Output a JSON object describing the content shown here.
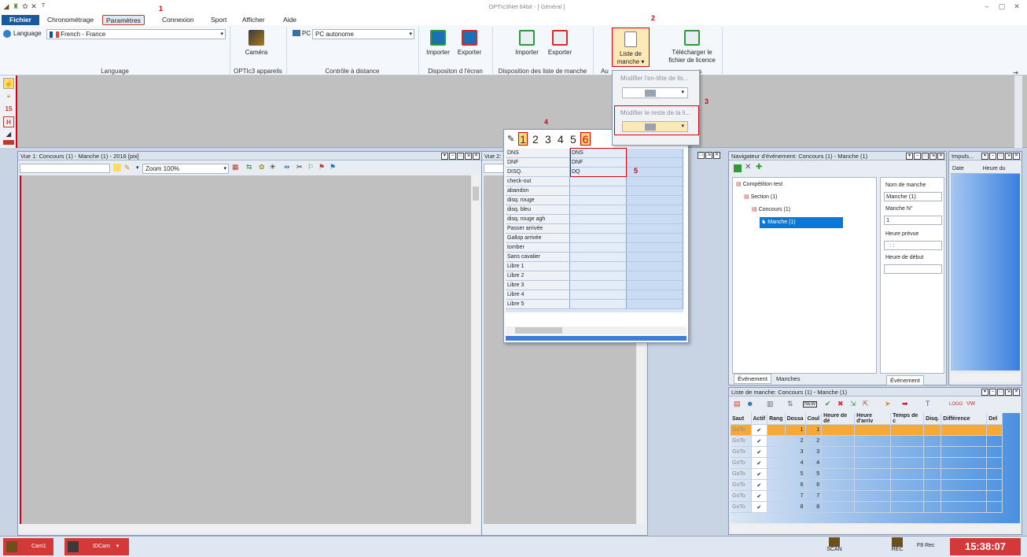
{
  "window": {
    "title": "OPTIc3Net 64bit - [ Général ]",
    "controls": [
      "–",
      "▢",
      "✕"
    ]
  },
  "menu": {
    "file": "Fichier",
    "items": [
      "Chronométrage",
      "Paramètres",
      "Connexion",
      "Sport",
      "Afficher",
      "Aide"
    ]
  },
  "annotations": [
    "1",
    "2",
    "3",
    "4",
    "5"
  ],
  "ribbon": {
    "language_label": "Language",
    "language_value": "French - France",
    "camera_label": "Caméra",
    "pc_label": "PC",
    "pc_value": "PC autonome",
    "btn_importer": "Importer",
    "btn_exporter": "Exporter",
    "btn_liste_line1": "Liste de",
    "btn_liste_line2": "manche ▾",
    "btn_telecharger_line1": "Télécharger le",
    "btn_telecharger_line2": "fichier de licence",
    "groups": [
      "Language",
      "OPTIc3 appareils",
      "Contrôle à distance",
      "Dispositon d l'écran",
      "Disposition des liste de manche",
      "Au",
      "s"
    ]
  },
  "dropdown": {
    "item1": "Modifier l'en-tête de lis...",
    "item2": "Modifier le reste de la li..."
  },
  "view1": {
    "title": "Vue 1: Concours (1) - Manche (1) - 2016 [pix]",
    "zoom": "Zoom 100%"
  },
  "view2": {
    "title": "Vue 2: C"
  },
  "columns_popup": {
    "tabs": [
      "1",
      "2",
      "3",
      "4",
      "5",
      "6"
    ],
    "rows": [
      [
        "DNS",
        "DNS"
      ],
      [
        "DNF",
        "DNF"
      ],
      [
        "DISQ.",
        "DQ"
      ],
      [
        "check-out",
        ""
      ],
      [
        "abandon",
        ""
      ],
      [
        "disq. rouge",
        ""
      ],
      [
        "disq. bleu",
        ""
      ],
      [
        "disq. rouge agh",
        ""
      ],
      [
        "Passer arrivée",
        ""
      ],
      [
        "Gallop arrivée",
        ""
      ],
      [
        "tomber",
        ""
      ],
      [
        "Sans cavalier",
        ""
      ],
      [
        "Libre 1",
        ""
      ],
      [
        "Libre 2",
        ""
      ],
      [
        "Libre 3",
        ""
      ],
      [
        "Libre 4",
        ""
      ],
      [
        "Libre 5",
        ""
      ]
    ]
  },
  "navigator": {
    "title": "Navigateur d'événement: Concours (1) - Manche (1)",
    "tree": [
      "Compétition test",
      "Section (1)",
      "Concours (1)",
      "Manche (1)"
    ],
    "props": {
      "nom_label": "Nom de manche",
      "nom_value": "Manche (1)",
      "num_label": "Manche N°",
      "num_value": "1",
      "heure_prevue_label": "Heure prévue",
      "heure_prevue_value": ": :",
      "heure_debut_label": "Heure de début"
    },
    "tabs": [
      "Événement",
      "Manches"
    ],
    "tab_right": "Événement"
  },
  "impulse": {
    "title": "Impuls...",
    "cols": [
      "Date",
      "Heure du"
    ]
  },
  "startlist": {
    "title": "Liste de manche: Concours (1) - Manche (1)",
    "headers": [
      "Saut",
      "Actif",
      "Rang",
      "Dossa",
      "Coul",
      "Heure de dé",
      "Heure d'arriv",
      "Temps de c",
      "Disq.",
      "Différence",
      "Del"
    ],
    "rows": [
      {
        "saut": "GoTo",
        "dossard": "1",
        "couloir": "1"
      },
      {
        "saut": "GoTo",
        "dossard": "2",
        "couloir": "2"
      },
      {
        "saut": "GoTo",
        "dossard": "3",
        "couloir": "3"
      },
      {
        "saut": "GoTo",
        "dossard": "4",
        "couloir": "4"
      },
      {
        "saut": "GoTo",
        "dossard": "5",
        "couloir": "5"
      },
      {
        "saut": "GoTo",
        "dossard": "6",
        "couloir": "6"
      },
      {
        "saut": "GoTo",
        "dossard": "7",
        "couloir": "7"
      },
      {
        "saut": "GoTo",
        "dossard": "8",
        "couloir": "8"
      }
    ],
    "toolbar_new": "NEW",
    "toolbar_logo": "LOGO"
  },
  "statusbar": {
    "cam1": "Cam1",
    "idcam": "IDCam",
    "scan": "SCAN",
    "rec": "REC",
    "f8rec": "F8 Rec",
    "clock": "15:38:07"
  }
}
